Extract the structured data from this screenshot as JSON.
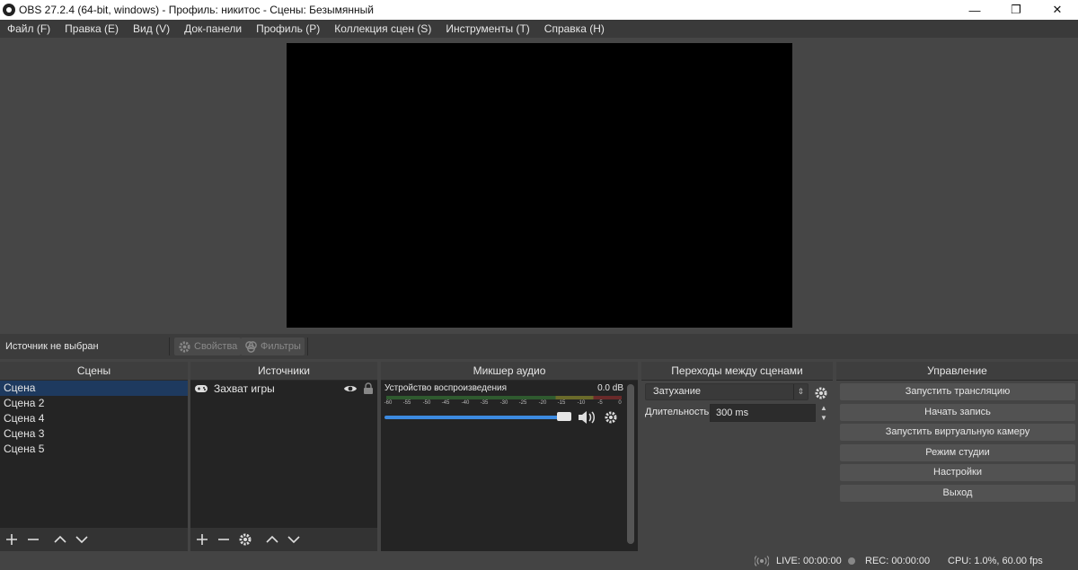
{
  "window": {
    "title": "OBS 27.2.4 (64-bit, windows) - Профиль: никитос - Сцены: Безымянный",
    "minimize": "—",
    "restore": "❐",
    "close": "✕"
  },
  "menu": [
    "Файл (F)",
    "Правка (E)",
    "Вид (V)",
    "Док-панели",
    "Профиль (P)",
    "Коллекция сцен (S)",
    "Инструменты (T)",
    "Справка (H)"
  ],
  "context": {
    "source_label": "Источник не выбран",
    "properties_label": "Свойства",
    "filters_label": "Фильтры"
  },
  "scenes": {
    "header": "Сцены",
    "items": [
      "Сцена",
      "Сцена 2",
      "Сцена 4",
      "Сцена 3",
      "Сцена 5"
    ],
    "selected_index": 0
  },
  "sources": {
    "header": "Источники",
    "items": [
      {
        "name": "Захват игры",
        "icon": "gamepad-icon",
        "visible": true,
        "locked": true
      }
    ]
  },
  "mixer": {
    "header": "Микшер аудио",
    "channel_name": "Устройство воспроизведения",
    "channel_db": "0.0 dB",
    "ticks": [
      "-60",
      "-55",
      "-50",
      "-45",
      "-40",
      "-35",
      "-30",
      "-25",
      "-20",
      "-15",
      "-10",
      "-5",
      "0"
    ],
    "volume_fraction": 0.92
  },
  "transitions": {
    "header": "Переходы между сценами",
    "selected": "Затухание",
    "duration_label": "Длительность",
    "duration_value": "300 ms"
  },
  "controls": {
    "header": "Управление",
    "buttons": [
      "Запустить трансляцию",
      "Начать запись",
      "Запустить виртуальную камеру",
      "Режим студии",
      "Настройки",
      "Выход"
    ]
  },
  "status": {
    "live": "LIVE: 00:00:00",
    "rec": "REC: 00:00:00",
    "cpu": "CPU: 1.0%, 60.00 fps"
  },
  "colors": {
    "accent": "#3c8ae0",
    "selection": "#1e3a5f",
    "panel": "#444444"
  }
}
